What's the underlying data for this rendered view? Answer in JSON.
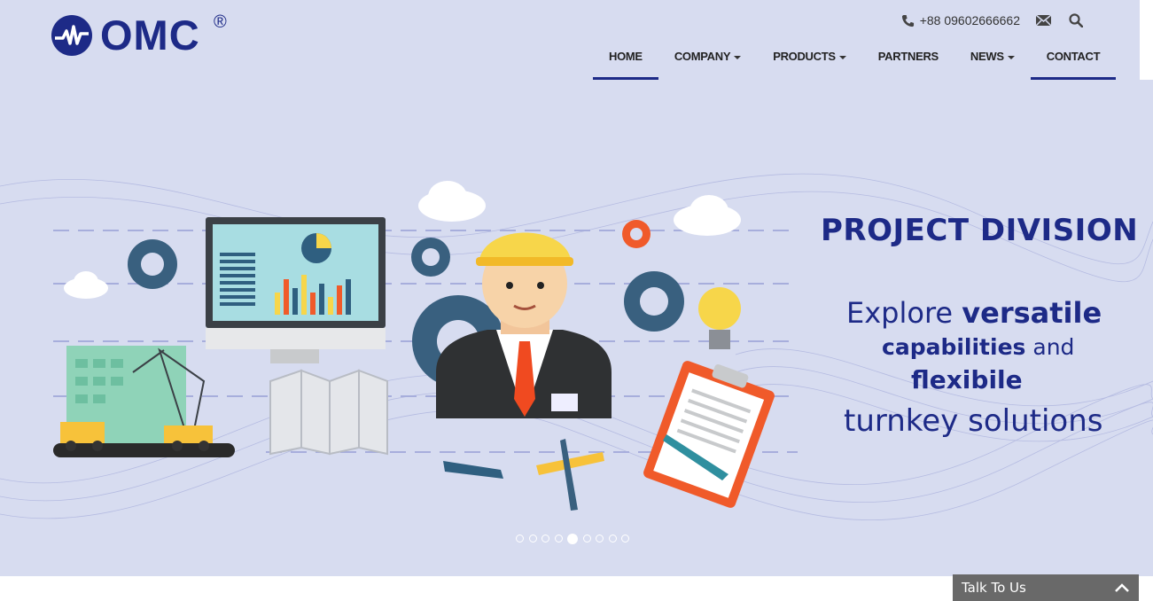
{
  "brand": {
    "name": "OMC",
    "registered": "®",
    "color": "#1d2a87"
  },
  "header": {
    "phone": "+88 09602666662",
    "icons": [
      "phone-icon",
      "mail-icon",
      "search-icon"
    ]
  },
  "nav": {
    "items": [
      {
        "label": "HOME",
        "active": true,
        "dropdown": false
      },
      {
        "label": "COMPANY",
        "active": false,
        "dropdown": true
      },
      {
        "label": "PRODUCTS",
        "active": false,
        "dropdown": true
      },
      {
        "label": "PARTNERS",
        "active": false,
        "dropdown": false
      },
      {
        "label": "NEWS",
        "active": false,
        "dropdown": true
      },
      {
        "label": "CONTACT",
        "active": true,
        "dropdown": false
      }
    ]
  },
  "hero": {
    "headline": "PROJECT DIVISION",
    "tagline": {
      "line1_light": "Explore",
      "line1_bold": "versatile",
      "line2_bold": "capabilities",
      "line2_light": "and",
      "line3_bold": "flexibile",
      "line4_light": "turnkey solutions"
    },
    "background": "#d7dcf0",
    "slides_total": 9,
    "slide_active": 5
  },
  "chat": {
    "label": "Talk To Us",
    "icon": "chevron-up-icon"
  }
}
